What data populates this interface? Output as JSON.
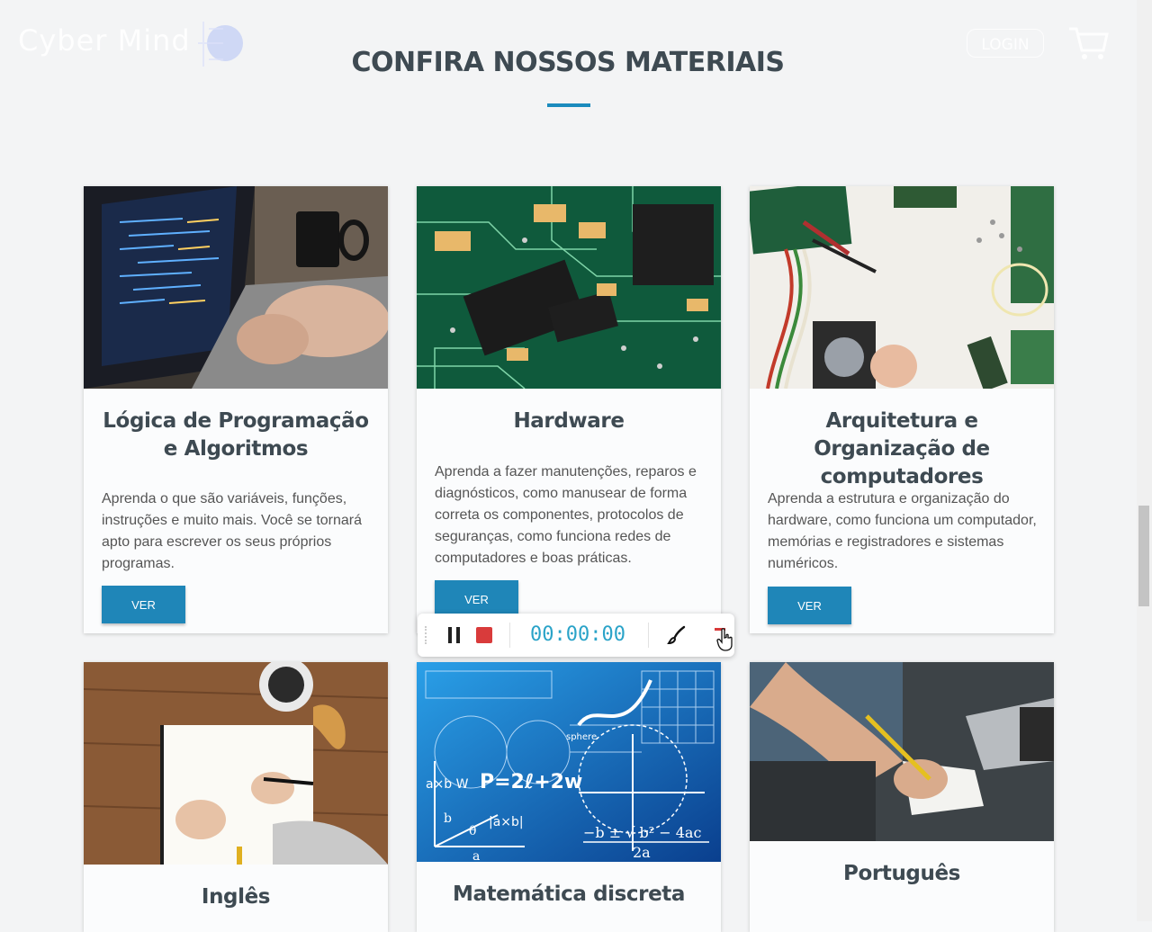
{
  "header": {
    "brand": "Cyber Mind",
    "login_label": "LOGIN"
  },
  "section": {
    "title": "CONFIRA NOSSOS MATERIAIS"
  },
  "cards": [
    {
      "title": "Lógica de Programação e Algoritmos",
      "description": "Aprenda o que são variáveis, funções, instruções e muito mais. Você se tornará apto para escrever os seus próprios programas.",
      "button": "VER"
    },
    {
      "title": "Hardware",
      "description": "Aprenda a fazer manutenções, reparos e diagnósticos, como manusear de forma correta os componentes, protocolos de seguranças, como funciona redes de computadores e boas práticas.",
      "button": "VER"
    },
    {
      "title": "Arquitetura e Organização de computadores",
      "description": "Aprenda a estrutura e organização do hardware, como funciona um computador, memórias e registradores e sistemas numéricos.",
      "button": "VER"
    },
    {
      "title": "Inglês"
    },
    {
      "title": "Matemática discreta"
    },
    {
      "title": "Português"
    }
  ],
  "recorder": {
    "time": "00:00:00"
  },
  "math_image": {
    "formula_main": "P=2ℓ+2w",
    "formula_quad": "−b ± √ b² − 4ac",
    "formula_den": "2a",
    "label_sphere": "sphere",
    "label_vec": "|a×b|",
    "label_w": "a×b W",
    "label_b": "b",
    "label_theta": "θ",
    "label_a": "a"
  },
  "colors": {
    "accent": "#1b8bbd",
    "button": "#1f86b8",
    "title": "#3e4a52",
    "record": "#d93b3b",
    "timer": "#2aa3c8"
  }
}
